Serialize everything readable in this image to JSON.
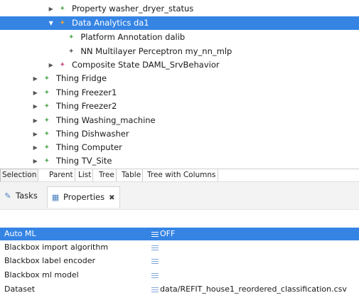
{
  "tree": {
    "rows": [
      {
        "label": "Property washer_dryer_status",
        "icon": "green-diamond-icon",
        "expanded": false
      },
      {
        "label": "Data Analytics da1",
        "icon": "orange-diamond-icon",
        "expanded": true,
        "selected": true
      },
      {
        "label": "Platform Annotation dalib",
        "icon": "green-diamond-icon"
      },
      {
        "label": "NN Multilayer Perceptron my_nn_mlp",
        "icon": "gray-diamond-icon"
      },
      {
        "label": "Composite State DAML_SrvBehavior",
        "icon": "pink-diamond-icon",
        "expanded": false
      },
      {
        "label": "Thing Fridge",
        "icon": "green-diamond-icon",
        "expanded": false
      },
      {
        "label": "Thing Freezer1",
        "icon": "green-diamond-icon",
        "expanded": false
      },
      {
        "label": "Thing Freezer2",
        "icon": "green-diamond-icon",
        "expanded": false
      },
      {
        "label": "Thing Washing_machine",
        "icon": "green-diamond-icon",
        "expanded": false
      },
      {
        "label": "Thing Dishwasher",
        "icon": "green-diamond-icon",
        "expanded": false
      },
      {
        "label": "Thing Computer",
        "icon": "green-diamond-icon",
        "expanded": false
      },
      {
        "label": "Thing TV_Site",
        "icon": "green-diamond-icon",
        "expanded": false
      }
    ]
  },
  "editor_tabs": [
    "Selection",
    "Parent",
    "List",
    "Tree",
    "Table",
    "Tree with Columns"
  ],
  "view_tabs": {
    "tasks": "Tasks",
    "properties": "Properties"
  },
  "properties": {
    "rows": [
      {
        "key": "Auto ML",
        "value": "OFF",
        "selected": true
      },
      {
        "key": "Blackbox import algorithm",
        "value": ""
      },
      {
        "key": "Blackbox label encoder",
        "value": ""
      },
      {
        "key": "Blackbox ml model",
        "value": ""
      },
      {
        "key": "Dataset",
        "value": "data/REFIT_house1_reordered_classification.csv"
      }
    ]
  },
  "colors": {
    "selection": "#3584e4",
    "thing_icon": "#5fae5f",
    "composite_state_icon": "#c8568a",
    "data_analytics_icon": "#e8a33a"
  }
}
